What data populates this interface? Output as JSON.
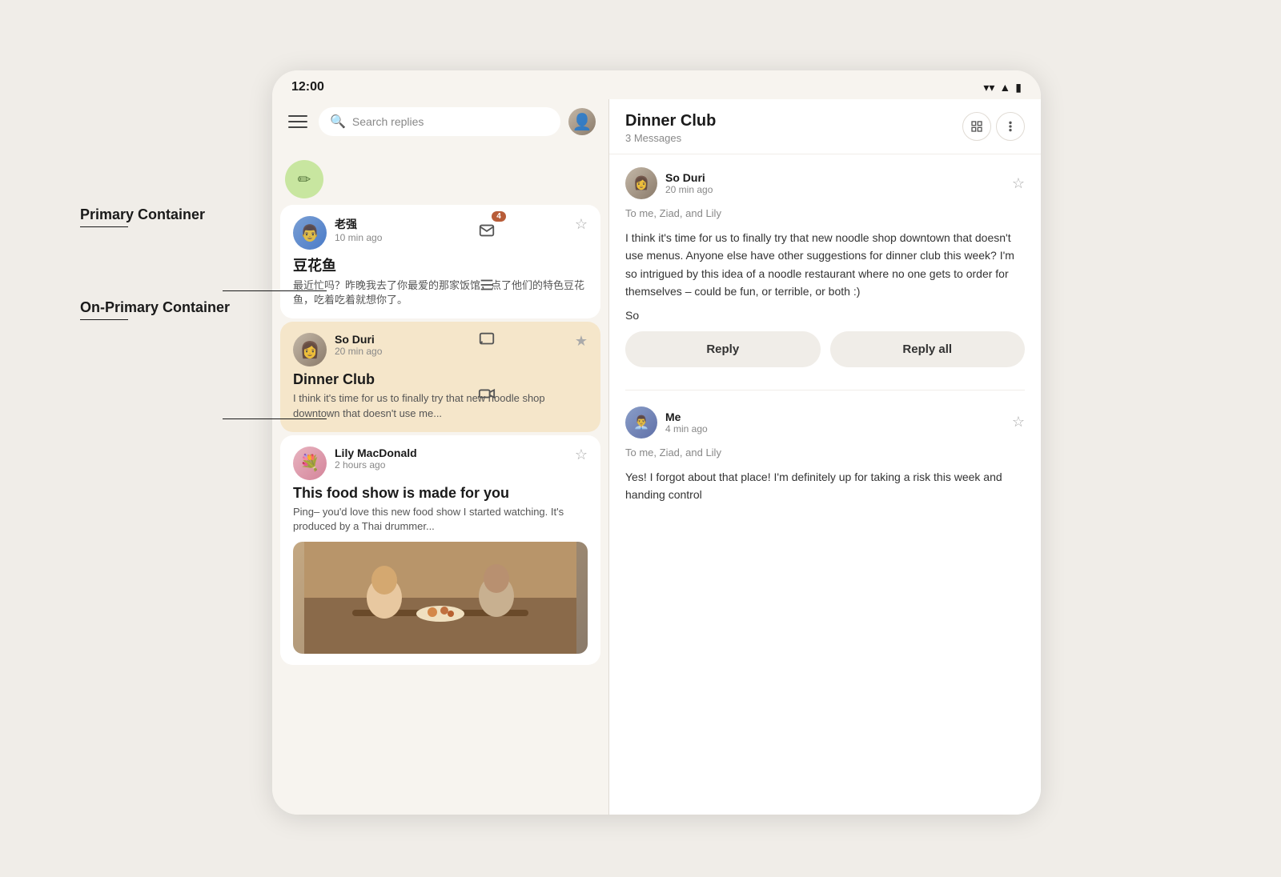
{
  "status_bar": {
    "time": "12:00",
    "icons": [
      "wifi",
      "signal",
      "battery"
    ]
  },
  "labels": {
    "primary_container": {
      "title": "Primary Container",
      "line_width": 60
    },
    "on_primary_container": {
      "title": "On-Primary Container",
      "line_width": 60
    }
  },
  "search": {
    "placeholder": "Search replies"
  },
  "nav_icons": [
    "menu",
    "compose",
    "mail-with-badge",
    "list",
    "chat",
    "video"
  ],
  "compose_badge_count": "4",
  "emails": [
    {
      "id": "email-1",
      "sender": "老强",
      "time": "10 min ago",
      "subject": "豆花鱼",
      "preview": "最近忙吗？昨晚我去了你最爱的那家饭馆，点了他们的特色豆花鱼，吃着吃着就想你了。",
      "starred": false,
      "avatar_color": "av-laochan"
    },
    {
      "id": "email-2",
      "sender": "So Duri",
      "time": "20 min ago",
      "subject": "Dinner Club",
      "preview": "I think it's time for us to finally try that new noodle shop downtown that doesn't use me...",
      "starred": true,
      "selected": true,
      "avatar_color": "av-soduri"
    },
    {
      "id": "email-3",
      "sender": "Lily MacDonald",
      "time": "2 hours ago",
      "subject": "This food show is made for you",
      "preview": "Ping– you'd love this new food show I started watching. It's produced by a Thai drummer...",
      "starred": false,
      "has_thumbnail": true,
      "avatar_color": "av-lily"
    }
  ],
  "detail": {
    "title": "Dinner Club",
    "subtitle": "3 Messages",
    "messages": [
      {
        "id": "msg-1",
        "sender": "So Duri",
        "time": "20 min ago",
        "to": "To me, Ziad, and Lily",
        "body": "I think it's time for us to finally try that new noodle shop downtown that doesn't use menus. Anyone else have other suggestions for dinner club this week? I'm so intrigued by this idea of a noodle restaurant where no one gets to order for themselves – could be fun, or terrible, or both :)",
        "sign": "So",
        "starred": false,
        "avatar_color": "av-soduri"
      },
      {
        "id": "msg-2",
        "sender": "Me",
        "time": "4 min ago",
        "to": "To me, Ziad, and Lily",
        "body": "Yes! I forgot about that place! I'm definitely up for taking a risk this week and handing control",
        "starred": false,
        "avatar_color": "av-me"
      }
    ],
    "reply_button": "Reply",
    "reply_all_button": "Reply all"
  }
}
